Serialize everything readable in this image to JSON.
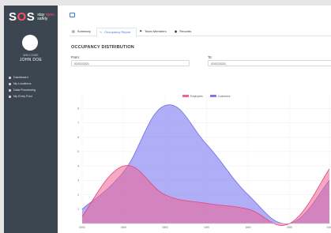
{
  "sidebar": {
    "logo_text_s1": "S",
    "logo_text_o": "O",
    "logo_text_s2": "S",
    "logo_tag_line1_a": "stay ",
    "logo_tag_line1_b": "open",
    "logo_tag_line2": "safely",
    "welcome": "WELCOME",
    "username": "JOHN DOE",
    "nav": [
      {
        "label": "Dashboard",
        "icon": "home-icon"
      },
      {
        "label": "My Locations",
        "icon": "location-icon"
      },
      {
        "label": "Data Processing",
        "icon": "document-icon"
      },
      {
        "label": "My Entry Pool",
        "icon": "pool-icon"
      }
    ]
  },
  "tabs": [
    {
      "label": "Summary",
      "icon": "summary-icon",
      "active": false
    },
    {
      "label": "Occupancy Report",
      "icon": "chart-icon",
      "active": true
    },
    {
      "label": "Team Members",
      "icon": "team-icon",
      "active": false
    },
    {
      "label": "Records",
      "icon": "records-icon",
      "active": false
    }
  ],
  "section_title": "OCCUPANCY DISTRIBUTION",
  "filters": {
    "from_label": "From:",
    "from_value": "02/02/2021",
    "to_label": "To:",
    "to_value": "02/02/2021"
  },
  "colors": {
    "employees": "#f06292",
    "customers": "#7b78f0",
    "sidebar": "#3c4650",
    "accent": "#3b7be8"
  },
  "chart_data": {
    "type": "area",
    "x": [
      "0000",
      "0400",
      "0800",
      "1200",
      "1600",
      "2000",
      "2400"
    ],
    "ylim": [
      0,
      9
    ],
    "yticks": [
      1,
      2,
      3,
      4,
      5,
      6,
      7,
      8
    ],
    "series": [
      {
        "name": "Employees",
        "color": "#f06292",
        "values": [
          0.5,
          4.0,
          2.0,
          1.4,
          1.0,
          0.0,
          3.8
        ]
      },
      {
        "name": "Customers",
        "color": "#7b78f0",
        "values": [
          1.0,
          3.6,
          8.2,
          5.5,
          2.0,
          0.0,
          3.0
        ]
      }
    ],
    "legend": "top-center"
  }
}
